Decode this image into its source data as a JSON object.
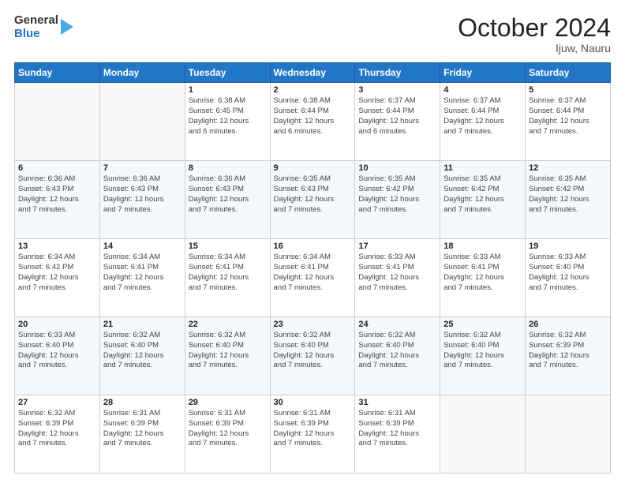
{
  "header": {
    "logo": {
      "general": "General",
      "blue": "Blue"
    },
    "month": "October 2024",
    "location": "Ijuw, Nauru"
  },
  "days_of_week": [
    "Sunday",
    "Monday",
    "Tuesday",
    "Wednesday",
    "Thursday",
    "Friday",
    "Saturday"
  ],
  "weeks": [
    [
      {
        "day": "",
        "info": ""
      },
      {
        "day": "",
        "info": ""
      },
      {
        "day": "1",
        "info": "Sunrise: 6:38 AM\nSunset: 6:45 PM\nDaylight: 12 hours\nand 6 minutes."
      },
      {
        "day": "2",
        "info": "Sunrise: 6:38 AM\nSunset: 6:44 PM\nDaylight: 12 hours\nand 6 minutes."
      },
      {
        "day": "3",
        "info": "Sunrise: 6:37 AM\nSunset: 6:44 PM\nDaylight: 12 hours\nand 6 minutes."
      },
      {
        "day": "4",
        "info": "Sunrise: 6:37 AM\nSunset: 6:44 PM\nDaylight: 12 hours\nand 7 minutes."
      },
      {
        "day": "5",
        "info": "Sunrise: 6:37 AM\nSunset: 6:44 PM\nDaylight: 12 hours\nand 7 minutes."
      }
    ],
    [
      {
        "day": "6",
        "info": "Sunrise: 6:36 AM\nSunset: 6:43 PM\nDaylight: 12 hours\nand 7 minutes."
      },
      {
        "day": "7",
        "info": "Sunrise: 6:36 AM\nSunset: 6:43 PM\nDaylight: 12 hours\nand 7 minutes."
      },
      {
        "day": "8",
        "info": "Sunrise: 6:36 AM\nSunset: 6:43 PM\nDaylight: 12 hours\nand 7 minutes."
      },
      {
        "day": "9",
        "info": "Sunrise: 6:35 AM\nSunset: 6:43 PM\nDaylight: 12 hours\nand 7 minutes."
      },
      {
        "day": "10",
        "info": "Sunrise: 6:35 AM\nSunset: 6:42 PM\nDaylight: 12 hours\nand 7 minutes."
      },
      {
        "day": "11",
        "info": "Sunrise: 6:35 AM\nSunset: 6:42 PM\nDaylight: 12 hours\nand 7 minutes."
      },
      {
        "day": "12",
        "info": "Sunrise: 6:35 AM\nSunset: 6:42 PM\nDaylight: 12 hours\nand 7 minutes."
      }
    ],
    [
      {
        "day": "13",
        "info": "Sunrise: 6:34 AM\nSunset: 6:42 PM\nDaylight: 12 hours\nand 7 minutes."
      },
      {
        "day": "14",
        "info": "Sunrise: 6:34 AM\nSunset: 6:41 PM\nDaylight: 12 hours\nand 7 minutes."
      },
      {
        "day": "15",
        "info": "Sunrise: 6:34 AM\nSunset: 6:41 PM\nDaylight: 12 hours\nand 7 minutes."
      },
      {
        "day": "16",
        "info": "Sunrise: 6:34 AM\nSunset: 6:41 PM\nDaylight: 12 hours\nand 7 minutes."
      },
      {
        "day": "17",
        "info": "Sunrise: 6:33 AM\nSunset: 6:41 PM\nDaylight: 12 hours\nand 7 minutes."
      },
      {
        "day": "18",
        "info": "Sunrise: 6:33 AM\nSunset: 6:41 PM\nDaylight: 12 hours\nand 7 minutes."
      },
      {
        "day": "19",
        "info": "Sunrise: 6:33 AM\nSunset: 6:40 PM\nDaylight: 12 hours\nand 7 minutes."
      }
    ],
    [
      {
        "day": "20",
        "info": "Sunrise: 6:33 AM\nSunset: 6:40 PM\nDaylight: 12 hours\nand 7 minutes."
      },
      {
        "day": "21",
        "info": "Sunrise: 6:32 AM\nSunset: 6:40 PM\nDaylight: 12 hours\nand 7 minutes."
      },
      {
        "day": "22",
        "info": "Sunrise: 6:32 AM\nSunset: 6:40 PM\nDaylight: 12 hours\nand 7 minutes."
      },
      {
        "day": "23",
        "info": "Sunrise: 6:32 AM\nSunset: 6:40 PM\nDaylight: 12 hours\nand 7 minutes."
      },
      {
        "day": "24",
        "info": "Sunrise: 6:32 AM\nSunset: 6:40 PM\nDaylight: 12 hours\nand 7 minutes."
      },
      {
        "day": "25",
        "info": "Sunrise: 6:32 AM\nSunset: 6:40 PM\nDaylight: 12 hours\nand 7 minutes."
      },
      {
        "day": "26",
        "info": "Sunrise: 6:32 AM\nSunset: 6:39 PM\nDaylight: 12 hours\nand 7 minutes."
      }
    ],
    [
      {
        "day": "27",
        "info": "Sunrise: 6:32 AM\nSunset: 6:39 PM\nDaylight: 12 hours\nand 7 minutes."
      },
      {
        "day": "28",
        "info": "Sunrise: 6:31 AM\nSunset: 6:39 PM\nDaylight: 12 hours\nand 7 minutes."
      },
      {
        "day": "29",
        "info": "Sunrise: 6:31 AM\nSunset: 6:39 PM\nDaylight: 12 hours\nand 7 minutes."
      },
      {
        "day": "30",
        "info": "Sunrise: 6:31 AM\nSunset: 6:39 PM\nDaylight: 12 hours\nand 7 minutes."
      },
      {
        "day": "31",
        "info": "Sunrise: 6:31 AM\nSunset: 6:39 PM\nDaylight: 12 hours\nand 7 minutes."
      },
      {
        "day": "",
        "info": ""
      },
      {
        "day": "",
        "info": ""
      }
    ]
  ]
}
